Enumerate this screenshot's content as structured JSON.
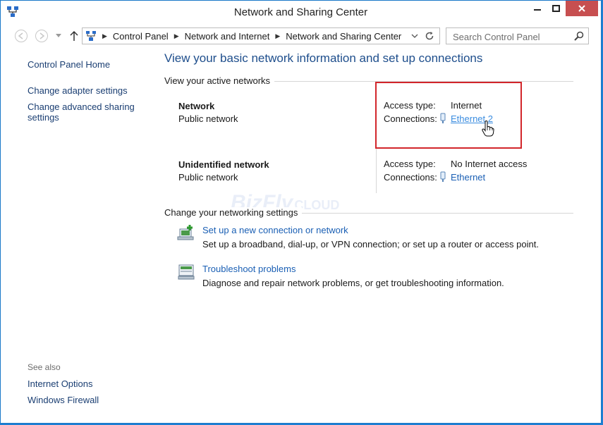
{
  "window": {
    "title": "Network and Sharing Center"
  },
  "address": {
    "crumbs": [
      "Control Panel",
      "Network and Internet",
      "Network and Sharing Center"
    ],
    "search_placeholder": "Search Control Panel"
  },
  "sidebar": {
    "home": "Control Panel Home",
    "adapter": "Change adapter settings",
    "advanced_line1": "Change advanced sharing",
    "advanced_line2": "settings",
    "see_also": "See also",
    "internet_options": "Internet Options",
    "firewall": "Windows Firewall"
  },
  "main": {
    "heading": "View your basic network information and set up connections",
    "active_label": "View your active networks",
    "networks": [
      {
        "name": "Network",
        "type": "Public network",
        "access_label": "Access type:",
        "access_value": "Internet",
        "conn_label": "Connections:",
        "conn_value": "Ethernet 2"
      },
      {
        "name": "Unidentified network",
        "type": "Public network",
        "access_label": "Access type:",
        "access_value": "No Internet access",
        "conn_label": "Connections:",
        "conn_value": "Ethernet"
      }
    ],
    "change_label": "Change your networking settings",
    "tasks": [
      {
        "title": "Set up a new connection or network",
        "desc": "Set up a broadband, dial-up, or VPN connection; or set up a router or access point."
      },
      {
        "title": "Troubleshoot problems",
        "desc": "Diagnose and repair network problems, or get troubleshooting information."
      }
    ]
  },
  "watermark": {
    "brand": "BizFly",
    "suffix": "CLOUD"
  },
  "colors": {
    "link": "#1a5fb4",
    "heading": "#1e4e8c",
    "highlight": "#d2262b",
    "close": "#c74f50"
  }
}
